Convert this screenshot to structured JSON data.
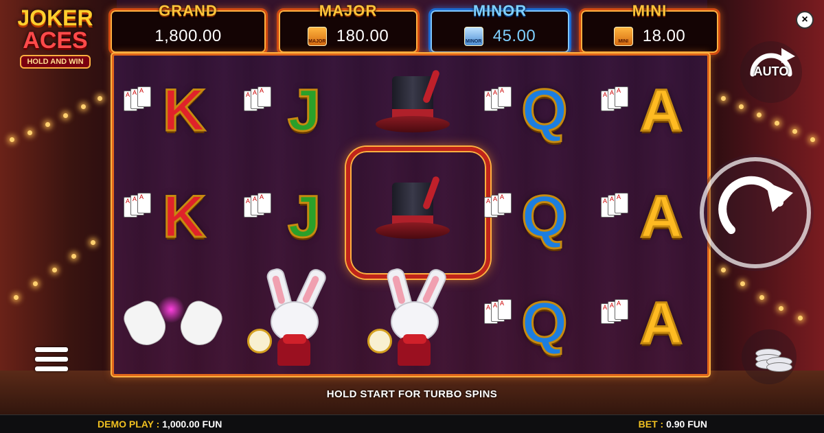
{
  "game": {
    "logo": {
      "line1": "JOKER",
      "line2": "ACES",
      "tag": "HOLD AND WIN"
    },
    "jackpots": [
      {
        "title": "GRAND",
        "value": "1,800.00",
        "badge": ""
      },
      {
        "title": "MAJOR",
        "value": "180.00",
        "badge": "MAJOR"
      },
      {
        "title": "MINOR",
        "value": "45.00",
        "badge": "MINOR"
      },
      {
        "title": "MINI",
        "value": "18.00",
        "badge": "MINI"
      }
    ],
    "reels": {
      "columns": 5,
      "rows": 3,
      "symbols": [
        [
          "K",
          "J",
          "top-hat",
          "Q",
          "A"
        ],
        [
          "K",
          "J",
          "top-hat",
          "Q",
          "A"
        ],
        [
          "white-gloves",
          "white-rabbit",
          "white-rabbit",
          "Q",
          "A"
        ]
      ],
      "highlighted": "row-2-col-3"
    },
    "buttons": {
      "auto_label": "AUTO",
      "close_glyph": "×"
    },
    "hint": "HOLD START FOR TURBO SPINS",
    "status": {
      "demo_label": "DEMO PLAY :",
      "demo_value": "1,000.00 FUN",
      "bet_label": "BET :",
      "bet_value": "0.90 FUN"
    },
    "colors": {
      "frame": "#e0661a",
      "gold": "#ffc53a",
      "minor_blue": "#7fd0ff"
    }
  }
}
